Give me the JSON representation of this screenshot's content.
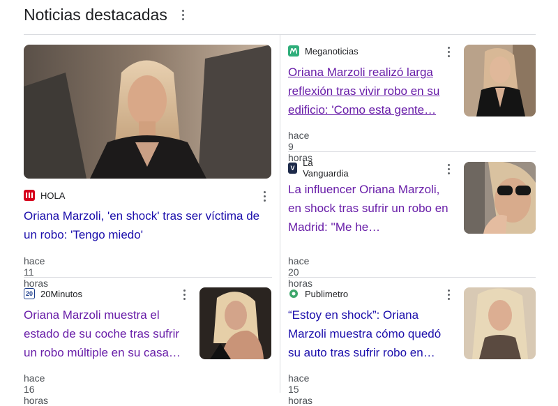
{
  "section": {
    "title": "Noticias destacadas"
  },
  "colors": {
    "link": "#1a0dab",
    "visited": "#681da8",
    "divider": "#dadce0"
  },
  "cards": [
    {
      "source": "HOLA",
      "favicon_icon": "hola-logo-icon",
      "headline": "Oriana Marzoli, 'en shock' tras ser víctima de un robo: 'Tengo miedo'",
      "time": "hace 11 horas"
    },
    {
      "source": "Meganoticias",
      "favicon_icon": "meganoticias-logo-icon",
      "headline": "Oriana Marzoli realizó larga reflexión tras vivir robo en su edificio: 'Como esta gente…",
      "time": "hace 9 horas"
    },
    {
      "source": "La Vanguardia",
      "favicon_icon": "la-vanguardia-logo-icon",
      "favicon_text": "V",
      "headline": "La influencer Oriana Marzoli, en shock tras sufrir un robo en Madrid: ''Me he…",
      "time": "hace 20 horas"
    },
    {
      "source": "20Minutos",
      "favicon_icon": "20minutos-logo-icon",
      "favicon_text": "20",
      "headline": "Oriana Marzoli muestra el estado de su coche tras sufrir un robo múltiple en su casa…",
      "time": "hace 16 horas"
    },
    {
      "source": "Publimetro",
      "favicon_icon": "publimetro-logo-icon",
      "headline": "“Estoy en shock”: Oriana Marzoli muestra cómo quedó su auto tras sufrir robo en…",
      "time": "hace 15 horas"
    }
  ]
}
